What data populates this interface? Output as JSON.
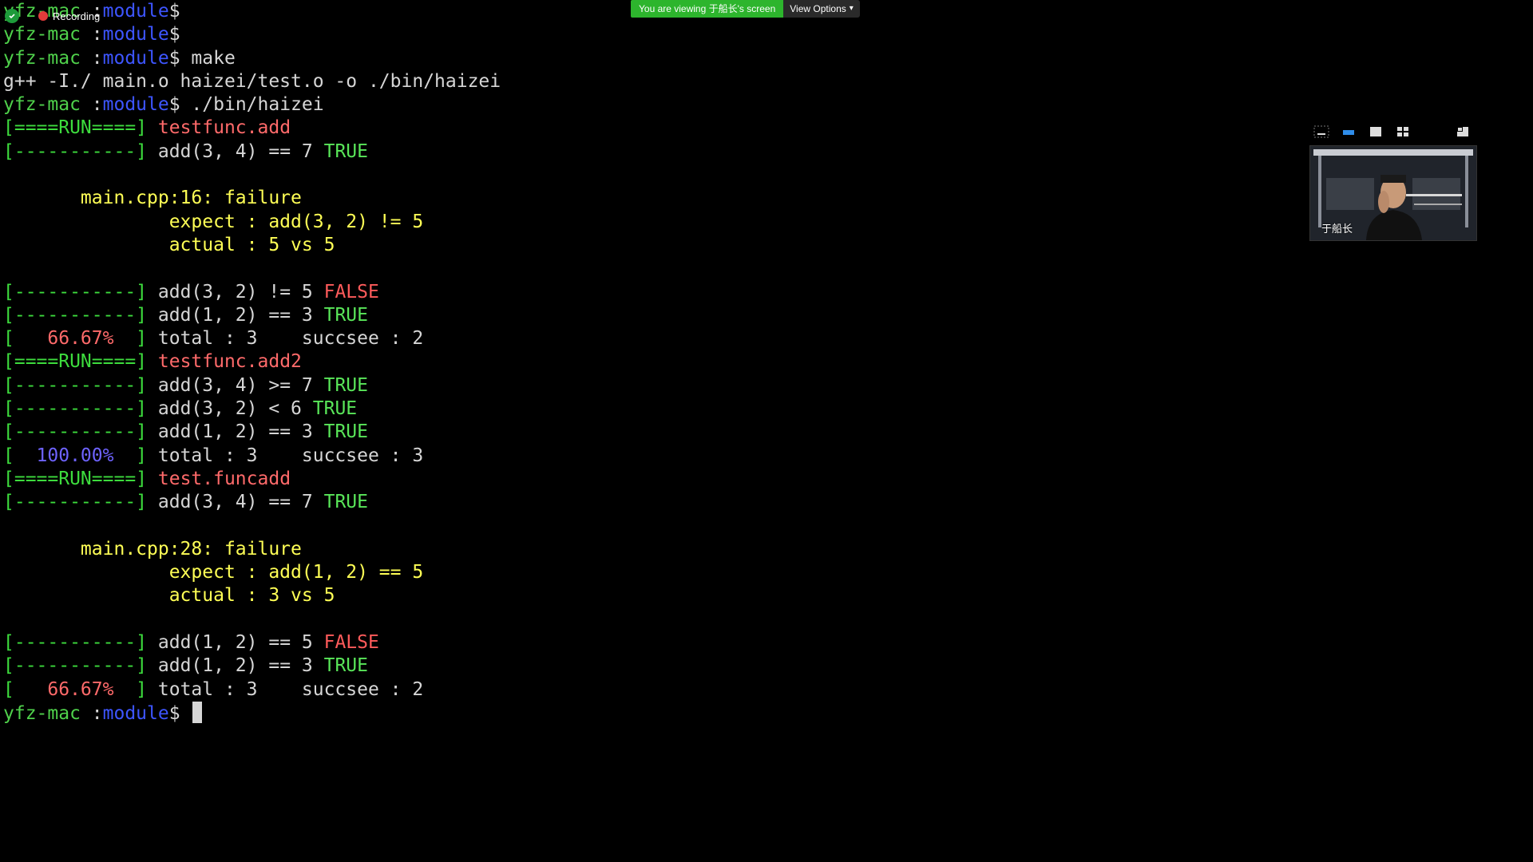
{
  "recording": {
    "label": "Recording"
  },
  "share_banner": {
    "status_text": "You are viewing 于船长's screen",
    "view_options_label": "View Options"
  },
  "video": {
    "participant_name": "于船长"
  },
  "colors": {
    "background": "#000000",
    "prompt_green": "#4fd14b",
    "dir_blue": "#3d55ff",
    "fail_red": "#ff5b5b",
    "pass_green": "#59e659",
    "warn_yellow": "#ffff55",
    "pct_ok_blue": "#6e63ff"
  },
  "terminal": {
    "lines": [
      [
        {
          "t": "yfz-mac ",
          "c": "prompt"
        },
        {
          "t": ":",
          "c": "plain"
        },
        {
          "t": "module",
          "c": "dir"
        },
        {
          "t": "$",
          "c": "plain"
        }
      ],
      [
        {
          "t": "yfz-mac ",
          "c": "prompt"
        },
        {
          "t": ":",
          "c": "plain"
        },
        {
          "t": "module",
          "c": "dir"
        },
        {
          "t": "$",
          "c": "plain"
        }
      ],
      [
        {
          "t": "yfz-mac ",
          "c": "prompt"
        },
        {
          "t": ":",
          "c": "plain"
        },
        {
          "t": "module",
          "c": "dir"
        },
        {
          "t": "$ make",
          "c": "plain"
        }
      ],
      [
        {
          "t": "g++ -I./ main.o haizei/test.o -o ./bin/haizei",
          "c": "plain"
        }
      ],
      [
        {
          "t": "yfz-mac ",
          "c": "prompt"
        },
        {
          "t": ":",
          "c": "plain"
        },
        {
          "t": "module",
          "c": "dir"
        },
        {
          "t": "$ ./bin/haizei",
          "c": "plain"
        }
      ],
      [
        {
          "t": "[====RUN====] ",
          "c": "green"
        },
        {
          "t": "testfunc.add",
          "c": "test"
        }
      ],
      [
        {
          "t": "[-----------] ",
          "c": "green"
        },
        {
          "t": "add(3, 4) == 7 ",
          "c": "plain"
        },
        {
          "t": "TRUE",
          "c": "pass"
        }
      ],
      [],
      [
        {
          "t": "       main.cpp:16: failure",
          "c": "warn"
        }
      ],
      [
        {
          "t": "               expect : add(3, 2) != 5",
          "c": "warn"
        }
      ],
      [
        {
          "t": "               actual : 5 vs 5",
          "c": "warn"
        }
      ],
      [],
      [
        {
          "t": "[-----------] ",
          "c": "green"
        },
        {
          "t": "add(3, 2) != 5 ",
          "c": "plain"
        },
        {
          "t": "FALSE",
          "c": "fail"
        }
      ],
      [
        {
          "t": "[-----------] ",
          "c": "green"
        },
        {
          "t": "add(1, 2) == 3 ",
          "c": "plain"
        },
        {
          "t": "TRUE",
          "c": "pass"
        }
      ],
      [
        {
          "t": "[   ",
          "c": "green"
        },
        {
          "t": "66.67%",
          "c": "pct-bad"
        },
        {
          "t": "  ] ",
          "c": "green"
        },
        {
          "t": "total : 3    succsee : 2",
          "c": "plain"
        }
      ],
      [
        {
          "t": "[====RUN====] ",
          "c": "green"
        },
        {
          "t": "testfunc.add2",
          "c": "test"
        }
      ],
      [
        {
          "t": "[-----------] ",
          "c": "green"
        },
        {
          "t": "add(3, 4) >= 7 ",
          "c": "plain"
        },
        {
          "t": "TRUE",
          "c": "pass"
        }
      ],
      [
        {
          "t": "[-----------] ",
          "c": "green"
        },
        {
          "t": "add(3, 2) < 6 ",
          "c": "plain"
        },
        {
          "t": "TRUE",
          "c": "pass"
        }
      ],
      [
        {
          "t": "[-----------] ",
          "c": "green"
        },
        {
          "t": "add(1, 2) == 3 ",
          "c": "plain"
        },
        {
          "t": "TRUE",
          "c": "pass"
        }
      ],
      [
        {
          "t": "[  ",
          "c": "green"
        },
        {
          "t": "100.00%",
          "c": "pct-ok"
        },
        {
          "t": "  ] ",
          "c": "green"
        },
        {
          "t": "total : 3    succsee : 3",
          "c": "plain"
        }
      ],
      [
        {
          "t": "[====RUN====] ",
          "c": "green"
        },
        {
          "t": "test.funcadd",
          "c": "test"
        }
      ],
      [
        {
          "t": "[-----------] ",
          "c": "green"
        },
        {
          "t": "add(3, 4) == 7 ",
          "c": "plain"
        },
        {
          "t": "TRUE",
          "c": "pass"
        }
      ],
      [],
      [
        {
          "t": "       main.cpp:28: failure",
          "c": "warn"
        }
      ],
      [
        {
          "t": "               expect : add(1, 2) == 5",
          "c": "warn"
        }
      ],
      [
        {
          "t": "               actual : 3 vs 5",
          "c": "warn"
        }
      ],
      [],
      [
        {
          "t": "[-----------] ",
          "c": "green"
        },
        {
          "t": "add(1, 2) == 5 ",
          "c": "plain"
        },
        {
          "t": "FALSE",
          "c": "fail"
        }
      ],
      [
        {
          "t": "[-----------] ",
          "c": "green"
        },
        {
          "t": "add(1, 2) == 3 ",
          "c": "plain"
        },
        {
          "t": "TRUE",
          "c": "pass"
        }
      ],
      [
        {
          "t": "[   ",
          "c": "green"
        },
        {
          "t": "66.67%",
          "c": "pct-bad"
        },
        {
          "t": "  ] ",
          "c": "green"
        },
        {
          "t": "total : 3    succsee : 2",
          "c": "plain"
        }
      ],
      [
        {
          "t": "yfz-mac ",
          "c": "prompt"
        },
        {
          "t": ":",
          "c": "plain"
        },
        {
          "t": "module",
          "c": "dir"
        },
        {
          "t": "$ ",
          "c": "plain"
        },
        {
          "cursor": true
        }
      ]
    ]
  }
}
